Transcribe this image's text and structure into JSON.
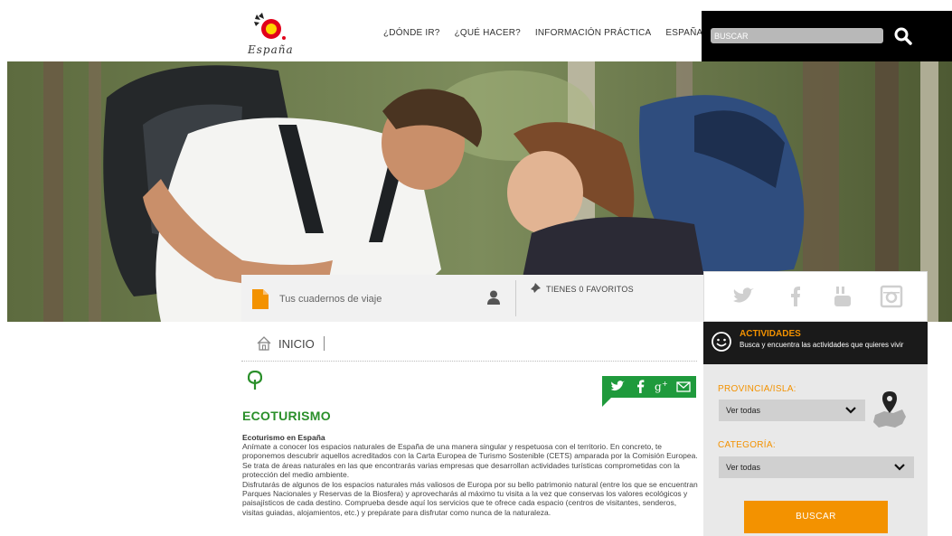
{
  "header": {
    "logo_text": "España",
    "nav": [
      "¿DÓNDE IR?",
      "¿QUÉ HACER?",
      "INFORMACIÓN PRÁCTICA",
      "ESPAÑA PARA..."
    ],
    "search_placeholder": "BUSCAR"
  },
  "favorites": {
    "notebook_label": "Tus cuadernos de viaje",
    "favorites_label": "TIENES 0 FAVORITOS"
  },
  "breadcrumb": {
    "home": "INICIO"
  },
  "section": {
    "title": "ECOTURISMO",
    "subtitle": "Ecoturismo en España",
    "paragraph1": "Anímate a conocer los espacios naturales de España de una manera singular y respetuosa con el territorio. En concreto, te proponemos descubrir aquellos acreditados con la Carta Europea de Turismo Sostenible (CETS) amparada por la Comisión Europea. Se trata de áreas naturales en las que encontrarás varias empresas que desarrollan actividades turísticas comprometidas con la protección del medio ambiente.",
    "paragraph2": "Disfrutarás de algunos de los espacios naturales más valiosos de Europa por su bello patrimonio natural (entre los que se encuentran Parques Nacionales y Reservas de la Biosfera) y aprovecharás al máximo tu visita a la vez que conservas los valores ecológicos y paisajísticos de cada destino. Comprueba desde aquí los servicios que te ofrece cada espacio (centros de visitantes, senderos, visitas guiadas, alojamientos, etc.) y prepárate para disfrutar como nunca de la naturaleza."
  },
  "sidebar": {
    "activities_title": "ACTIVIDADES",
    "activities_desc": "Busca y encuentra las actividades que quieres vivir",
    "province_label": "PROVINCIA/ISLA:",
    "province_value": "Ver todas",
    "category_label": "CATEGORÍA:",
    "category_value": "Ver todas",
    "search_button": "BUSCAR"
  },
  "colors": {
    "accent_orange": "#f39200",
    "eco_green": "#2a8f2a",
    "share_green": "#1f9a3c",
    "dark": "#1a1a1a"
  },
  "icons": [
    "search-icon",
    "notebook-icon",
    "user-icon",
    "pin-icon",
    "twitter-icon",
    "facebook-icon",
    "youtube-icon",
    "instagram-icon",
    "home-icon",
    "tree-icon",
    "googleplus-icon",
    "mail-icon",
    "smile-icon",
    "map-pin-icon",
    "chevron-down-icon"
  ]
}
